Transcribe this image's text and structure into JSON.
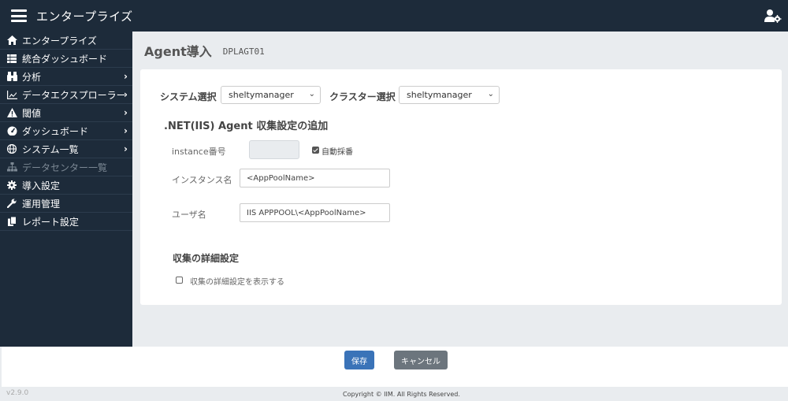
{
  "app": {
    "title": "エンタープライズ"
  },
  "sidebar": {
    "items": [
      {
        "label": "エンタープライズ",
        "icon": "home-icon",
        "chevron": false,
        "disabled": false
      },
      {
        "label": "統合ダッシュボード",
        "icon": "grid-icon",
        "chevron": false,
        "disabled": false
      },
      {
        "label": "分析",
        "icon": "binoculars-icon",
        "chevron": true,
        "disabled": false
      },
      {
        "label": "データエクスプローラー",
        "icon": "area-chart-icon",
        "chevron": true,
        "disabled": false
      },
      {
        "label": "閾値",
        "icon": "warning-icon",
        "chevron": true,
        "disabled": false
      },
      {
        "label": "ダッシュボード",
        "icon": "gauge-icon",
        "chevron": true,
        "disabled": false
      },
      {
        "label": "システム一覧",
        "icon": "globe-icon",
        "chevron": true,
        "disabled": false
      },
      {
        "label": "データセンター一覧",
        "icon": "sitemap-icon",
        "chevron": false,
        "disabled": true
      },
      {
        "label": "導入設定",
        "icon": "gear-icon",
        "chevron": false,
        "disabled": false
      },
      {
        "label": "運用管理",
        "icon": "wrench-icon",
        "chevron": false,
        "disabled": false
      },
      {
        "label": "レポート設定",
        "icon": "copy-icon",
        "chevron": false,
        "disabled": false
      }
    ]
  },
  "header": {
    "title": "Agent導入",
    "code": "DPLAGT01"
  },
  "form": {
    "system_label": "システム選択",
    "system_value": "sheltymanager",
    "cluster_label": "クラスター選択",
    "cluster_value": "sheltymanager",
    "section_title": ".NET(IIS) Agent 収集設定の追加",
    "instance_no_label": "instance番号",
    "instance_no_value": "",
    "auto_number_label": "自動採番",
    "auto_number_checked": true,
    "instance_name_label": "インスタンス名",
    "instance_name_value": "<AppPoolName>",
    "user_label": "ユーザ名",
    "user_value": "IIS APPPOOL\\<AppPoolName>",
    "detail_title": "収集の詳細設定",
    "detail_checkbox_label": "収集の詳細設定を表示する",
    "detail_checked": false
  },
  "footer": {
    "save_label": "保存",
    "cancel_label": "キャンセル",
    "version": "v2.9.0",
    "copyright": "Copyright © IIM. All Rights Reserved."
  },
  "colors": {
    "sidebar_bg": "#1d2b3a",
    "primary": "#3a73b8",
    "secondary": "#6c757d"
  }
}
